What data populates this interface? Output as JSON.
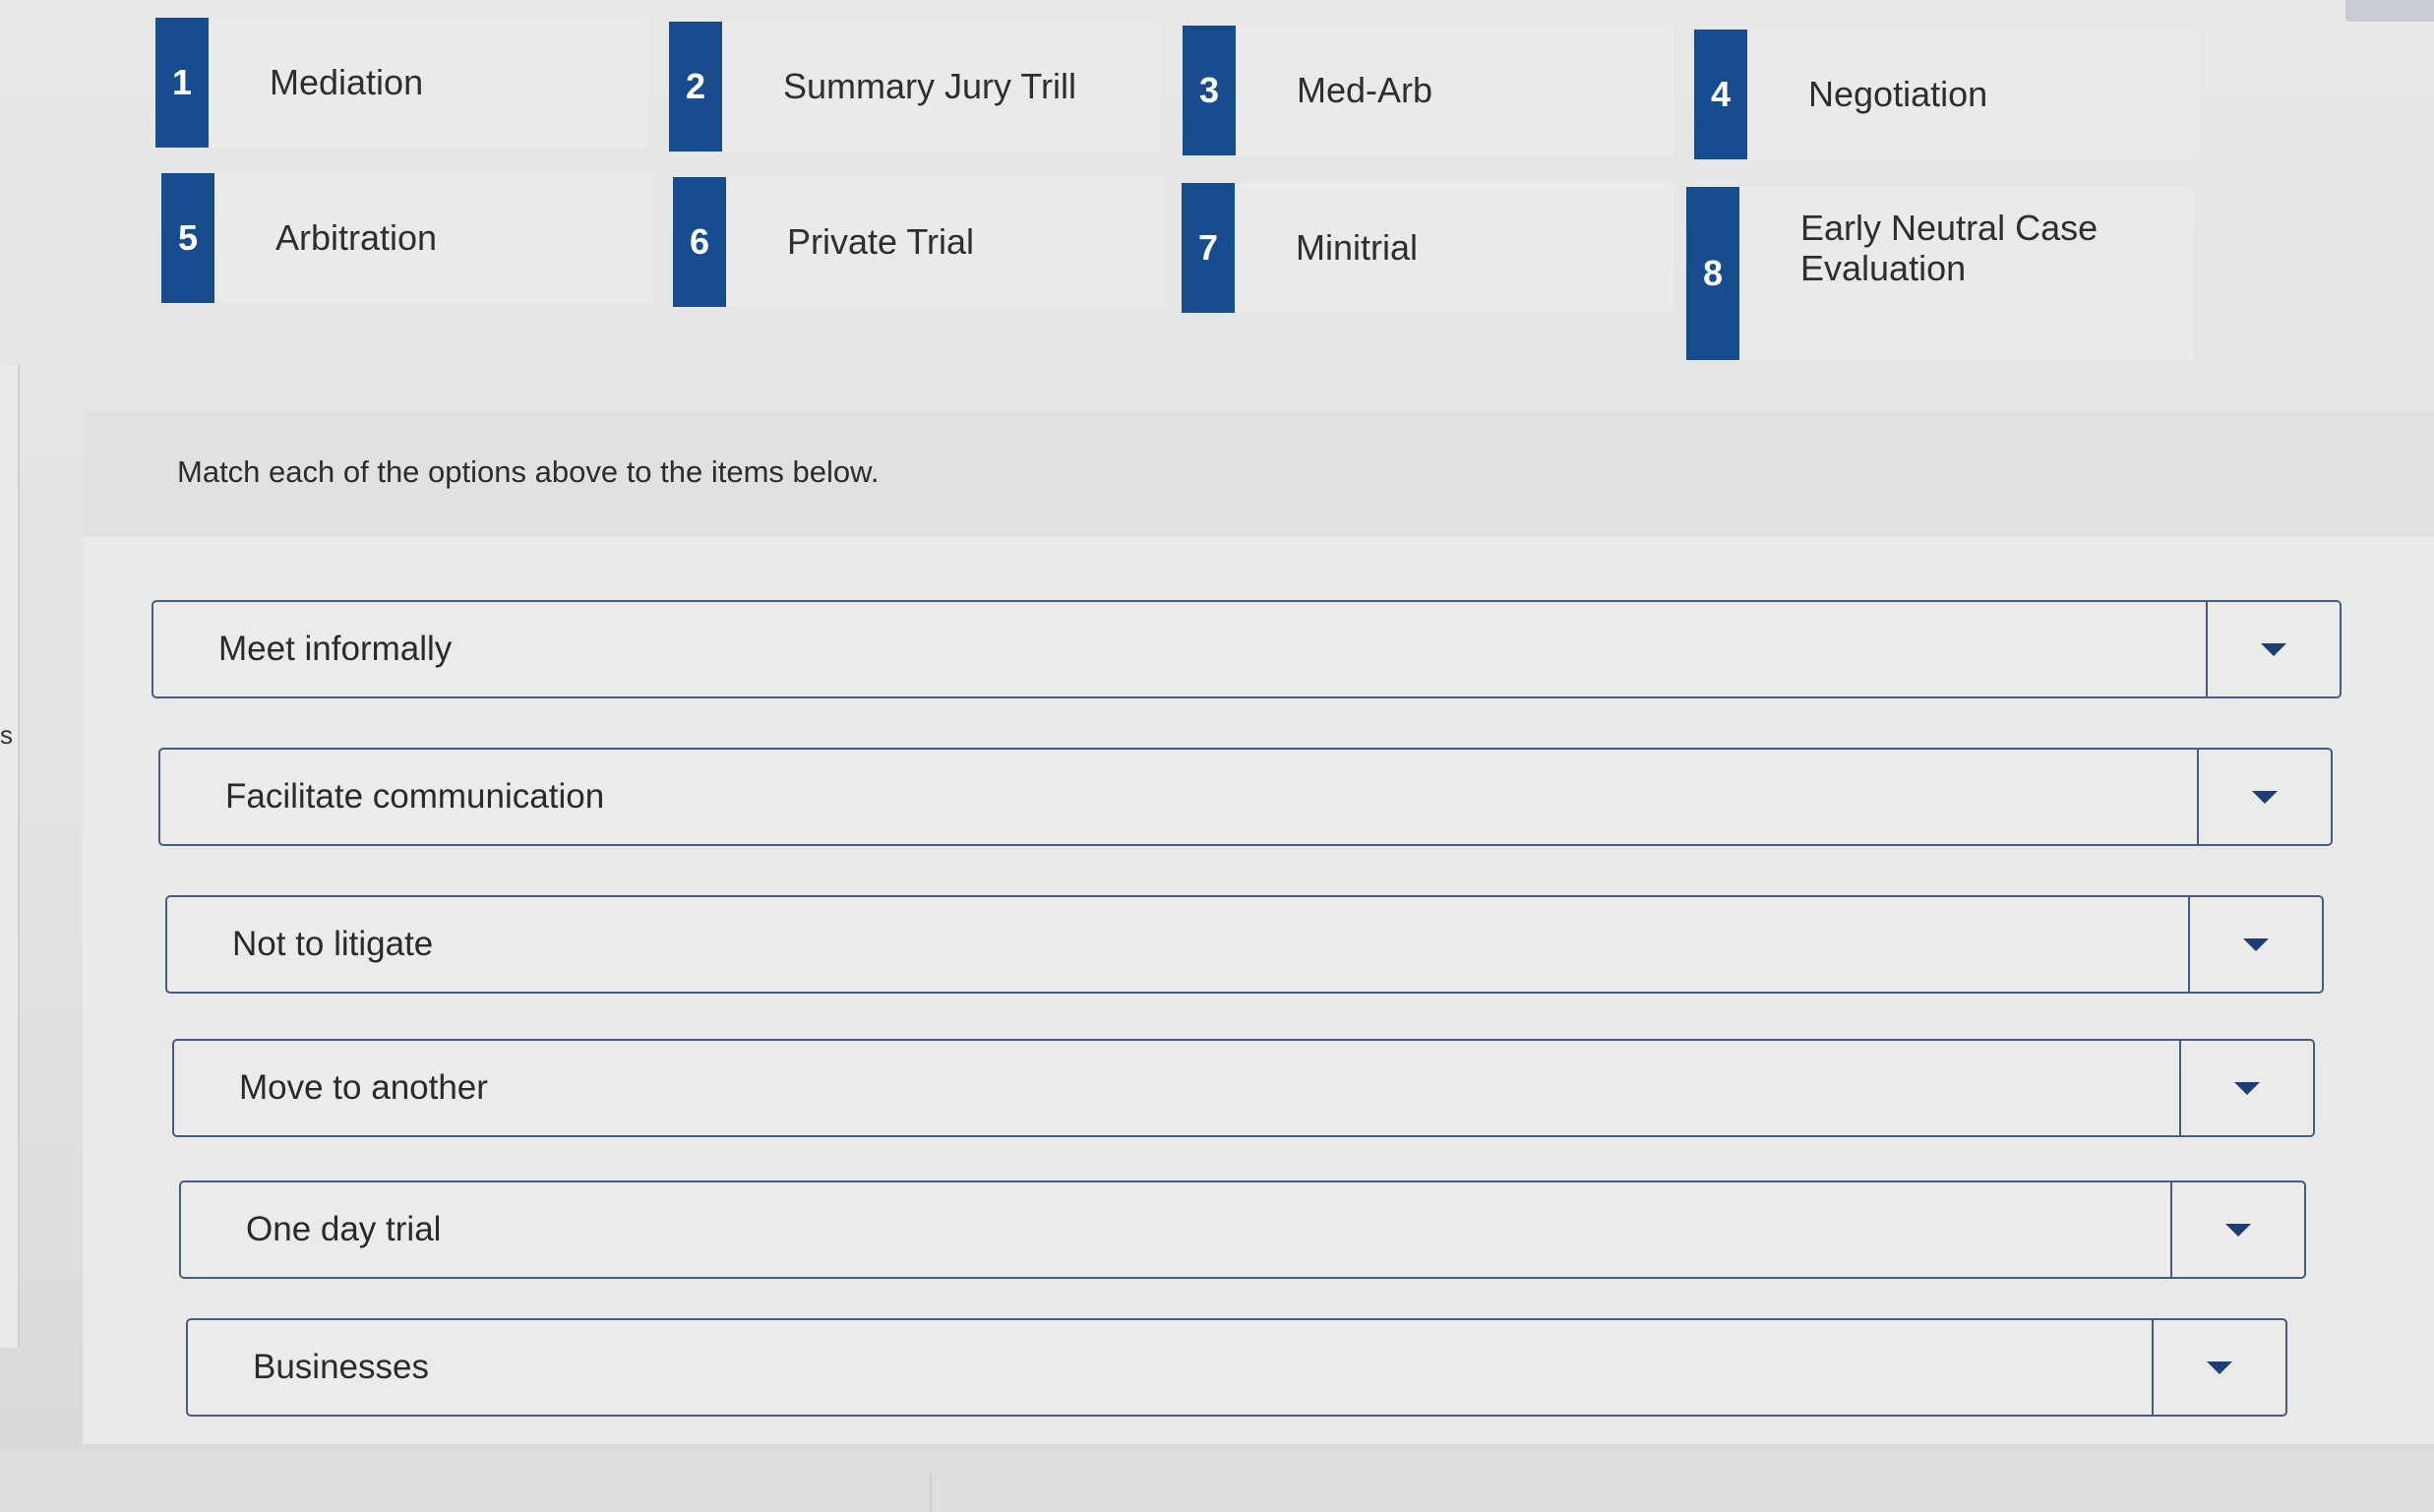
{
  "instructions": "Match each of the options above to the items below.",
  "side_text": "s",
  "options": [
    {
      "number": "1",
      "label": "Mediation"
    },
    {
      "number": "2",
      "label": "Summary Jury Trill"
    },
    {
      "number": "3",
      "label": "Med-Arb"
    },
    {
      "number": "4",
      "label": "Negotiation"
    },
    {
      "number": "5",
      "label": "Arbitration"
    },
    {
      "number": "6",
      "label": "Private Trial"
    },
    {
      "number": "7",
      "label": "Minitrial"
    },
    {
      "number": "8",
      "label": "Early Neutral Case Evaluation"
    }
  ],
  "items": [
    {
      "text": "Meet informally"
    },
    {
      "text": "Facilitate communication"
    },
    {
      "text": "Not to litigate"
    },
    {
      "text": "Move to another"
    },
    {
      "text": "One day trial"
    },
    {
      "text": "Businesses"
    }
  ],
  "colors": {
    "accent": "#174c8f",
    "row_border": "#4a5a86",
    "caret": "#1b3e74"
  },
  "icons": {
    "dropdown": "chevron-down-icon"
  }
}
